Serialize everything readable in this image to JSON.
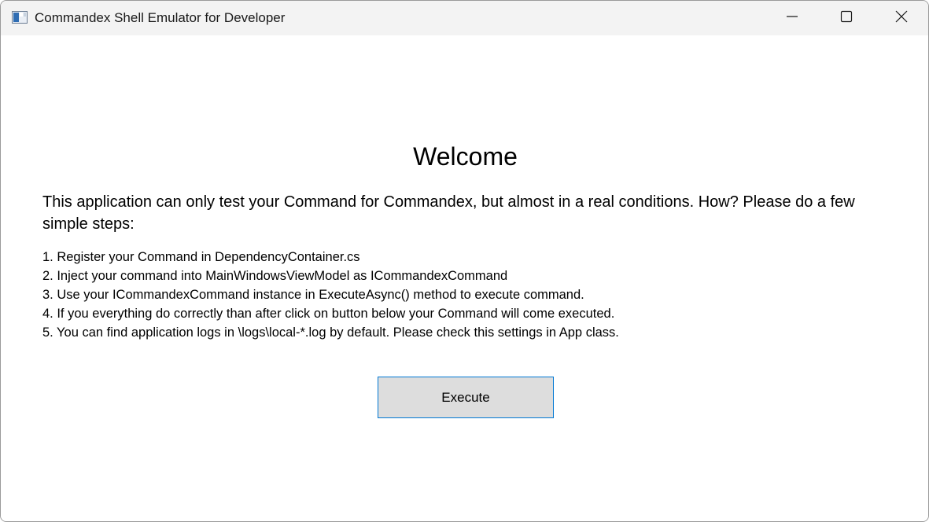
{
  "window": {
    "title": "Commandex Shell Emulator for Developer",
    "icon": "app-window-icon",
    "controls": [
      "minimize-icon",
      "maximize-icon",
      "close-icon"
    ]
  },
  "main": {
    "heading": "Welcome",
    "intro": "This application can only test your Command for Commandex, but almost in a real conditions. How? Please do a few simple steps:",
    "steps": [
      "1. Register your Command in DependencyContainer.cs",
      "2. Inject your command into MainWindowsViewModel as ICommandexCommand",
      "3. Use your ICommandexCommand instance in ExecuteAsync() method to execute command.",
      "4. If you everything do correctly than after click on button below your Command will come executed.",
      "5. You can find application logs in \\logs\\local-*.log by default. Please check this settings in App class."
    ],
    "execute_label": "Execute"
  },
  "colors": {
    "titlebar": "#f3f3f3",
    "button_bg": "#dddddd",
    "button_border": "#0078d4"
  }
}
